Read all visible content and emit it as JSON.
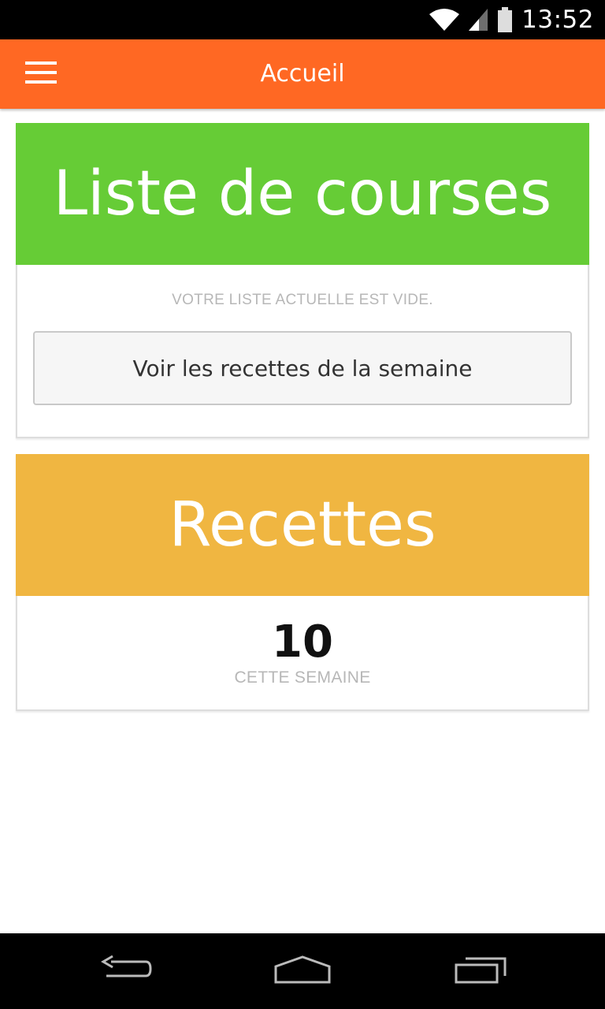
{
  "status_bar": {
    "time": "13:52",
    "icons": [
      "wifi-icon",
      "cell-signal-icon",
      "battery-icon"
    ]
  },
  "app_bar": {
    "title": "Accueil",
    "menu_icon": "menu-icon",
    "background_color": "#ff6823"
  },
  "shopping_card": {
    "title": "Liste de courses",
    "header_color": "#66cc36",
    "empty_message": "VOTRE LISTE ACTUELLE EST VIDE.",
    "button_label": "Voir les recettes de la semaine"
  },
  "recipes_card": {
    "title": "Recettes",
    "header_color": "#f0b641",
    "count": "10",
    "count_label": "CETTE SEMAINE"
  },
  "nav_bar": {
    "buttons": [
      "back-icon",
      "home-icon",
      "recent-apps-icon"
    ]
  }
}
